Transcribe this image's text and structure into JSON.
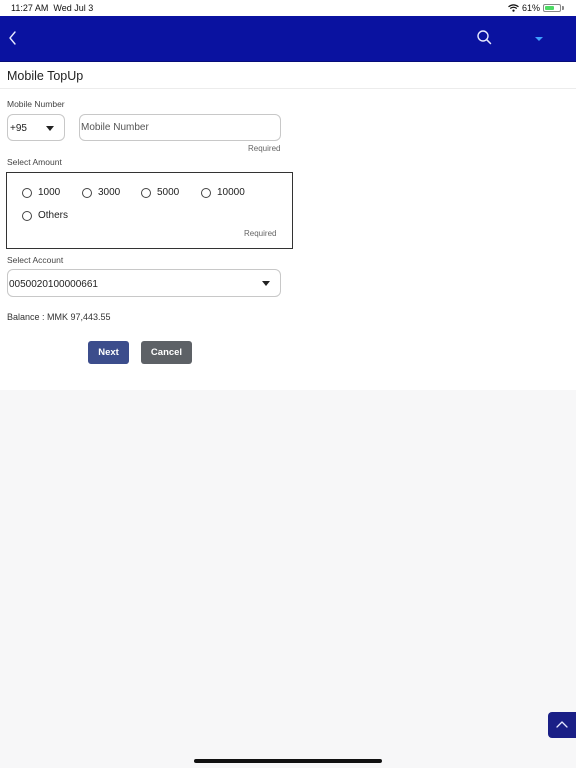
{
  "status_bar": {
    "time": "11:27 AM",
    "date": "Wed Jul 3",
    "battery": "61%",
    "battery_level": 0.61,
    "icons": [
      "wifi-icon",
      "battery-icon"
    ]
  },
  "navbar": {
    "background": "#0a12a0",
    "icons": [
      "back-chevron-icon",
      "search-icon",
      "dropdown-caret-icon"
    ]
  },
  "page": {
    "title": "Mobile TopUp"
  },
  "form": {
    "mobile_number_label": "Mobile Number",
    "country_code": "+95",
    "mobile_placeholder": "Mobile Number",
    "mobile_required": "Required",
    "amount_label": "Select Amount",
    "amount_options": [
      "1000",
      "3000",
      "5000",
      "10000",
      "Others"
    ],
    "amount_required": "Required",
    "account_label": "Select Account",
    "account_value": "0050020100000661",
    "balance": "Balance : MMK 97,443.55"
  },
  "buttons": {
    "next": "Next",
    "cancel": "Cancel"
  },
  "colors": {
    "accent": "#0a12a0",
    "next_button": "#3c4d8c",
    "cancel_button": "#5d6166"
  }
}
